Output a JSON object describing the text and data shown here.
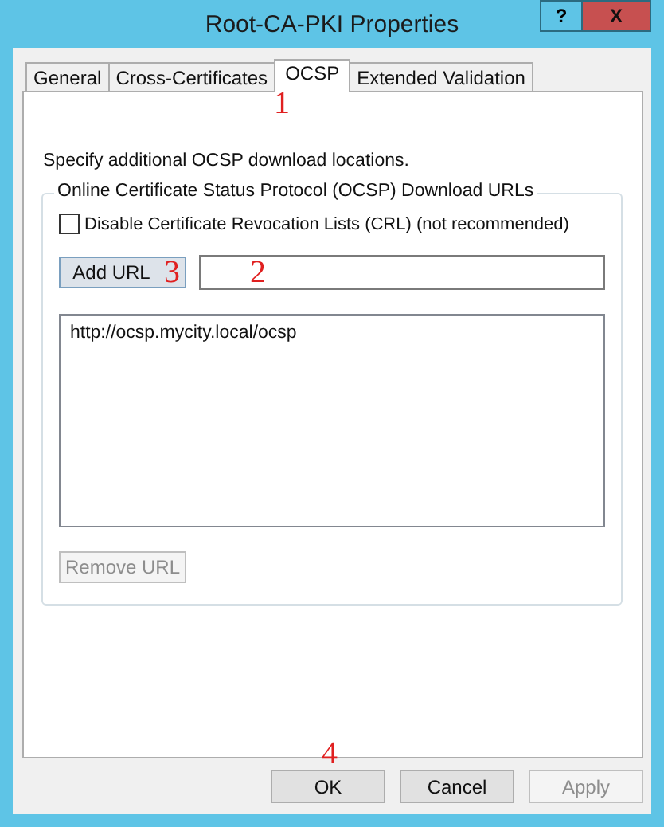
{
  "window": {
    "title": "Root-CA-PKI Properties",
    "help_button": "?",
    "close_button": "X"
  },
  "tabs": [
    {
      "label": "General",
      "selected": false
    },
    {
      "label": "Cross-Certificates",
      "selected": false
    },
    {
      "label": "OCSP",
      "selected": true
    },
    {
      "label": "Extended Validation",
      "selected": false
    }
  ],
  "description": "Specify additional OCSP download locations.",
  "group": {
    "title": "Online Certificate Status Protocol (OCSP) Download URLs",
    "checkbox": {
      "label": "Disable Certificate Revocation Lists (CRL)  (not recommended)",
      "checked": false
    },
    "add_button": {
      "label": "Add URL",
      "disabled": false
    },
    "url_list": [
      "http://ocsp.mycity.local/ocsp"
    ],
    "remove_button": {
      "label": "Remove URL",
      "disabled": true
    }
  },
  "buttons": [
    {
      "label": "OK",
      "disabled": false
    },
    {
      "label": "Cancel",
      "disabled": false
    },
    {
      "label": "Apply",
      "disabled": true
    }
  ],
  "annotations": [
    "1",
    "2",
    "3",
    "4"
  ]
}
